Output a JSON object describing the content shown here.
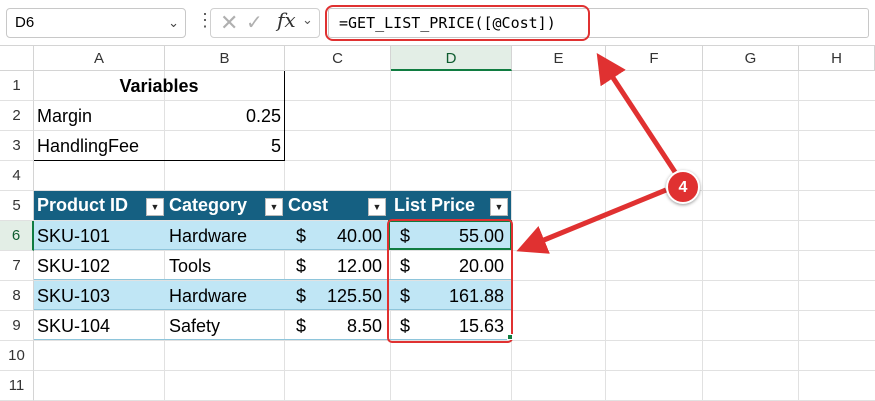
{
  "formula_bar": {
    "name_box": "D6",
    "fx_label": "fx",
    "formula": "=GET_LIST_PRICE([@Cost])"
  },
  "columns": [
    "A",
    "B",
    "C",
    "D",
    "E",
    "F",
    "G",
    "H"
  ],
  "selected_column": "D",
  "rows": [
    "1",
    "2",
    "3",
    "4",
    "5",
    "6",
    "7",
    "8",
    "9",
    "10",
    "11"
  ],
  "selected_row": "6",
  "variables": {
    "title": "Variables",
    "items": [
      {
        "name": "Margin",
        "value": "0.25"
      },
      {
        "name": "HandlingFee",
        "value": "5"
      }
    ]
  },
  "table": {
    "headers": [
      "Product ID",
      "Category",
      "Cost",
      "List Price"
    ],
    "currency_symbol": "$",
    "rows": [
      {
        "id": "SKU-101",
        "category": "Hardware",
        "cost": "40.00",
        "list_price": "55.00"
      },
      {
        "id": "SKU-102",
        "category": "Tools",
        "cost": "12.00",
        "list_price": "20.00"
      },
      {
        "id": "SKU-103",
        "category": "Hardware",
        "cost": "125.50",
        "list_price": "161.88"
      },
      {
        "id": "SKU-104",
        "category": "Safety",
        "cost": "8.50",
        "list_price": "15.63"
      }
    ]
  },
  "annotation": {
    "badge_number": "4",
    "color": "#e03131"
  },
  "colors": {
    "table_header": "#156082",
    "table_band": "#c0e6f5",
    "selection": "#107c41"
  }
}
